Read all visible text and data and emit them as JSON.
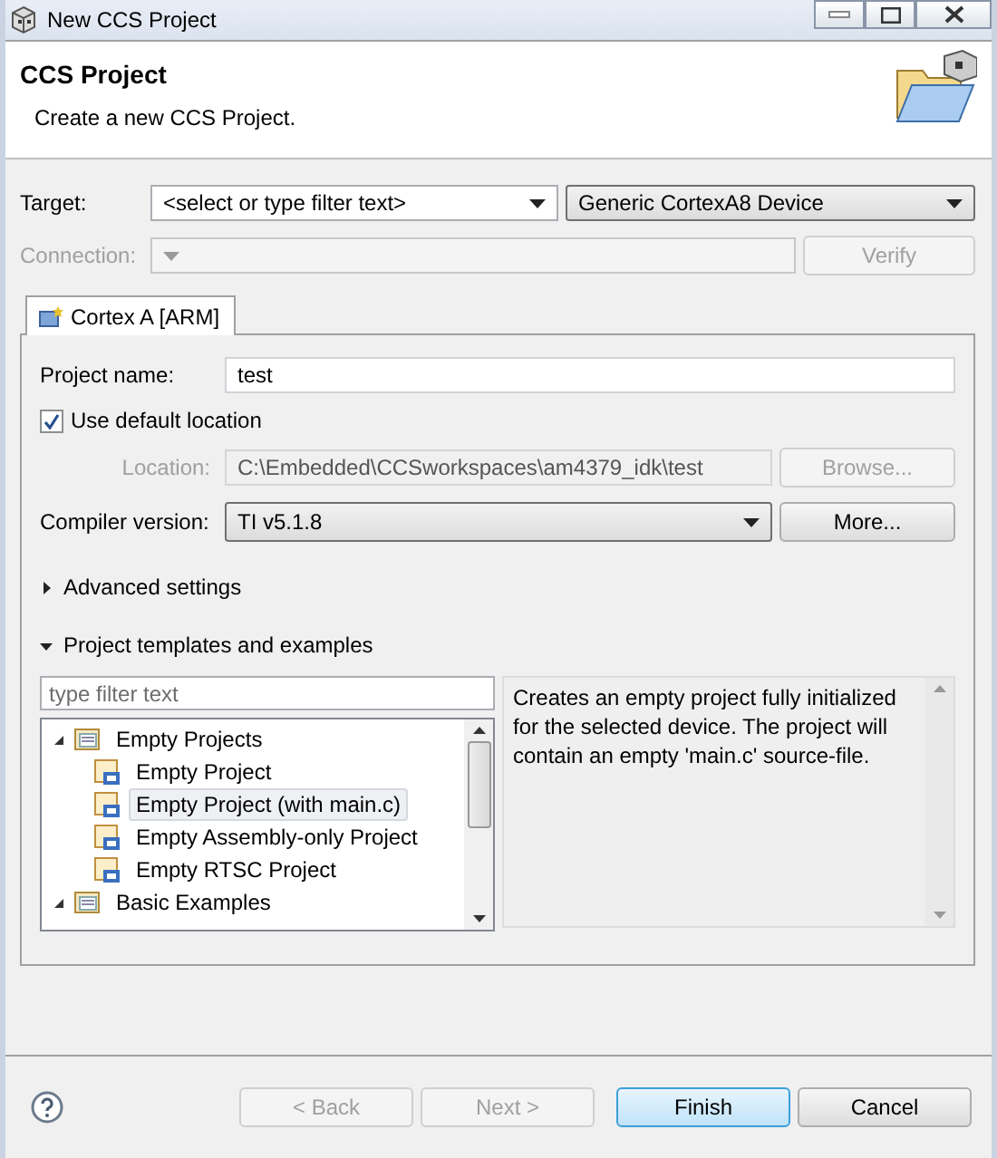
{
  "window": {
    "title": "New CCS Project"
  },
  "header": {
    "title": "CCS Project",
    "subtitle": "Create a new CCS Project."
  },
  "target": {
    "label": "Target:",
    "placeholder": "<select or type filter text>",
    "device": "Generic CortexA8 Device"
  },
  "connection": {
    "label": "Connection:",
    "disabled": true,
    "button": "Verify"
  },
  "tabs": [
    {
      "label": "Cortex A [ARM]",
      "selected": true
    }
  ],
  "project_name": {
    "label": "Project name:",
    "value": "test"
  },
  "use_default_location": {
    "label": "Use default location",
    "checked": true
  },
  "location": {
    "label": "Location:",
    "value": "C:\\Embedded\\CCSworkspaces\\am4379_idk\\test",
    "disabled": true,
    "button": "Browse..."
  },
  "compiler": {
    "label": "Compiler version:",
    "value": "TI v5.1.8",
    "button": "More..."
  },
  "sections": [
    {
      "label": "Advanced settings",
      "expanded": false
    },
    {
      "label": "Project templates and examples",
      "expanded": true
    }
  ],
  "templates": {
    "placeholder": "type filter text",
    "tree": [
      {
        "label": "Empty Projects",
        "expanded": true,
        "selected": false,
        "children": [
          {
            "label": "Empty Project",
            "selected": false
          },
          {
            "label": "Empty Project (with main.c)",
            "selected": true
          },
          {
            "label": "Empty Assembly-only Project",
            "selected": false
          },
          {
            "label": "Empty RTSC Project",
            "selected": false
          }
        ]
      },
      {
        "label": "Basic Examples",
        "expanded": true,
        "selected": false
      }
    ],
    "description": "Creates an empty project fully initialized for the selected device. The project will contain an empty 'main.c' source-file."
  },
  "buttons": [
    {
      "label": "< Back",
      "disabled": true,
      "default": false
    },
    {
      "label": "Next >",
      "disabled": true,
      "default": false
    },
    {
      "label": "Finish",
      "disabled": false,
      "default": true
    },
    {
      "label": "Cancel",
      "disabled": false,
      "default": false
    }
  ]
}
